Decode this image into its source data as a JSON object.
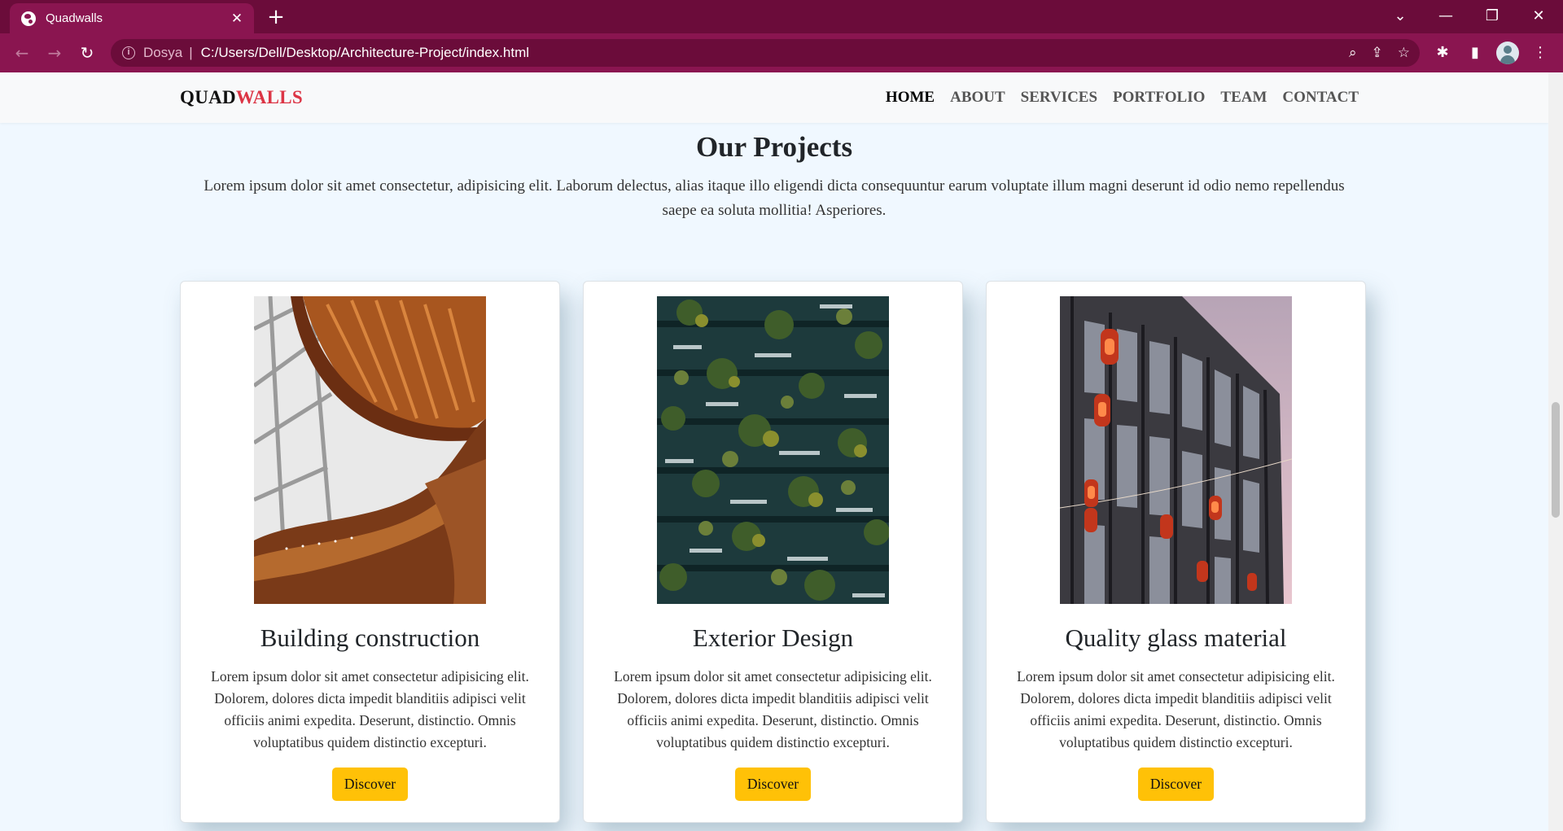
{
  "browser": {
    "tab_title": "Quadwalls",
    "tab_close": "✕",
    "new_tab": "+",
    "omnibox_scheme": "Dosya",
    "omnibox_separator": "|",
    "omnibox_url": "C:/Users/Dell/Desktop/Architecture-Project/index.html",
    "back_icon": "←",
    "forward_icon": "→",
    "reload_icon": "↻",
    "zoom_icon": "⌕",
    "share_icon": "⇪",
    "bookmark_icon": "☆",
    "extensions_icon": "✱",
    "sidepanel_icon": "▮",
    "menu_icon": "⋮",
    "tabsearch_icon": "⌄",
    "minimize_icon": "—",
    "restore_icon": "❐",
    "close_icon": "✕"
  },
  "site": {
    "brand_part1": "QUAD",
    "brand_part2": "WALLS",
    "brand_colors": {
      "primary": "#111111",
      "accent": "#dc3545"
    },
    "nav": {
      "items": [
        {
          "label": "HOME",
          "active": true
        },
        {
          "label": "ABOUT",
          "active": false
        },
        {
          "label": "SERVICES",
          "active": false
        },
        {
          "label": "PORTFOLIO",
          "active": false
        },
        {
          "label": "TEAM",
          "active": false
        },
        {
          "label": "CONTACT",
          "active": false
        }
      ]
    }
  },
  "projects": {
    "title": "Our Projects",
    "description": "Lorem ipsum dolor sit amet consectetur, adipisicing elit. Laborum delectus, alias itaque illo eligendi dicta consequuntur earum voluptate illum magni deserunt id odio nemo repellendus saepe ea soluta mollitia! Asperiores.",
    "button_color": "#ffc107",
    "cards": [
      {
        "image": "spiral-staircase-photo",
        "title": "Building construction",
        "text": "Lorem ipsum dolor sit amet consectetur adipisicing elit. Dolorem, dolores dicta impedit blanditiis adipisci velit officiis animi expedita. Deserunt, distinctio. Omnis voluptatibus quidem distinctio excepturi.",
        "button": "Discover"
      },
      {
        "image": "vertical-forest-building-photo",
        "title": "Exterior Design",
        "text": "Lorem ipsum dolor sit amet consectetur adipisicing elit. Dolorem, dolores dicta impedit blanditiis adipisci velit officiis animi expedita. Deserunt, distinctio. Omnis voluptatibus quidem distinctio excepturi.",
        "button": "Discover"
      },
      {
        "image": "glass-facade-lanterns-photo",
        "title": "Quality glass material",
        "text": "Lorem ipsum dolor sit amet consectetur adipisicing elit. Dolorem, dolores dicta impedit blanditiis adipisci velit officiis animi expedita. Deserunt, distinctio. Omnis voluptatibus quidem distinctio excepturi.",
        "button": "Discover"
      }
    ]
  }
}
